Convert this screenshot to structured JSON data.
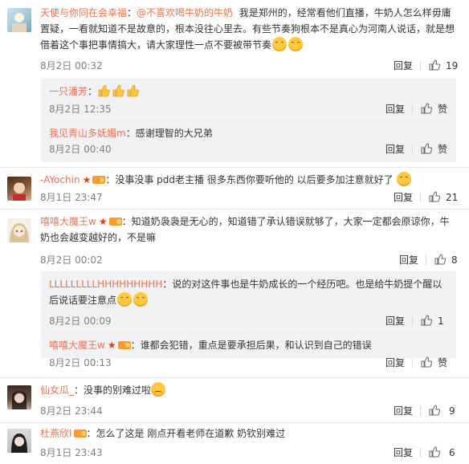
{
  "comments": [
    {
      "user": "天使与你同在会幸福",
      "mention": "@不喜欢喝牛奶的牛奶",
      "text_line1": "我是郑州的，经常看他们直播，牛奶人怎么样毋庸",
      "text_line2": "置疑，一看就知道不是故意的，根本没往心里去。有些节奏狗根本不是真心为河南人说话，就是想",
      "text_line3": "借着这个事把事情搞大，请大家理性一点不要被带节奏",
      "time": "8月2日 00:32",
      "reply_label": "回复",
      "likes": "19",
      "replies": [
        {
          "user": "一只潘芳",
          "text": "：",
          "time": "8月2日 12:35",
          "reply_label": "回复",
          "likes": "赞"
        },
        {
          "user": "我见青山多妩媚m",
          "text": "：感谢理智的大兄弟",
          "time": "8月2日 00:40",
          "reply_label": "回复",
          "likes": "赞"
        }
      ]
    },
    {
      "user": "-AYochin",
      "text": "：没事没事 pdd老主播 很多东西你要听他的 以后要多加注意就好了",
      "time": "8月1日 23:47",
      "reply_label": "回复",
      "likes": "21"
    },
    {
      "user": "嘻嘻大魔王w",
      "text_line1": "：知道奶袅袅是无心的，知道错了承认错误就够了，大家一定都会原谅你，牛",
      "text_line2": "奶也会越变越好的，不是嘛",
      "time": "8月2日 00:02",
      "reply_label": "回复",
      "likes": "8",
      "replies": [
        {
          "user": "LLLLLLLLLHHHHHHHHH",
          "text_line1": "：说的对这件事也是牛奶成长的一个经历吧。也是给牛奶提个醒以",
          "text_line2": "后说话要注意点",
          "time": "8月2日 00:09",
          "reply_label": "回复",
          "likes": "1"
        },
        {
          "user": "嘻嘻大魔王w",
          "text": "：谁都会犯错，重点是要承担后果，和认识到自己的错误",
          "time": "8月2日 00:13",
          "reply_label": "回复",
          "likes": "赞"
        }
      ]
    },
    {
      "user": "仙女瓜_",
      "text": "：没事的别难过啦",
      "time": "8月2日 23:44",
      "reply_label": "回复",
      "likes": "9"
    },
    {
      "user": "杜燕欣I",
      "text": "：怎么了这是 刚点开看老师在道歉 奶钦别难过",
      "time": "8月1日 23:43",
      "reply_label": "回复",
      "likes": "6"
    }
  ],
  "colors": {
    "username": "#eb7350",
    "meta": "#808080",
    "subbg": "#f2f2f5",
    "badge": "#e8410e"
  }
}
